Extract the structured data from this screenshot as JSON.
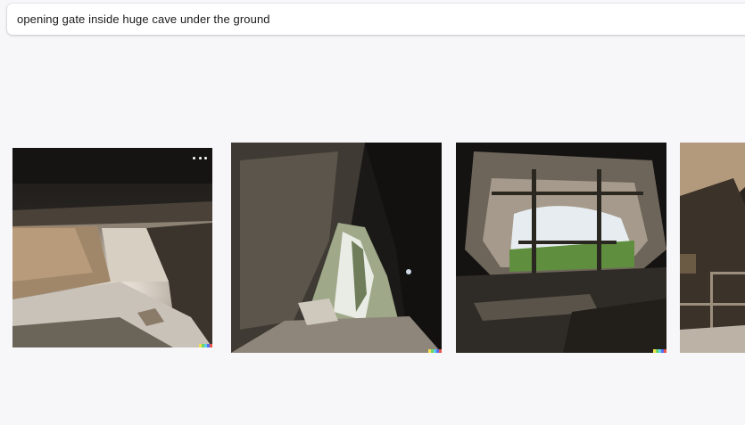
{
  "prompt": {
    "text": "opening gate inside huge cave under the ground"
  },
  "results": {
    "images": [
      {
        "name": "generated-image-1",
        "has_menu": true
      },
      {
        "name": "generated-image-2",
        "has_menu": false
      },
      {
        "name": "generated-image-3",
        "has_menu": false
      },
      {
        "name": "generated-image-4",
        "has_menu": false
      }
    ],
    "signature_colors": [
      "#f4e04d",
      "#6fd36a",
      "#5ad1e8",
      "#5b6cf0",
      "#e8534b"
    ]
  }
}
